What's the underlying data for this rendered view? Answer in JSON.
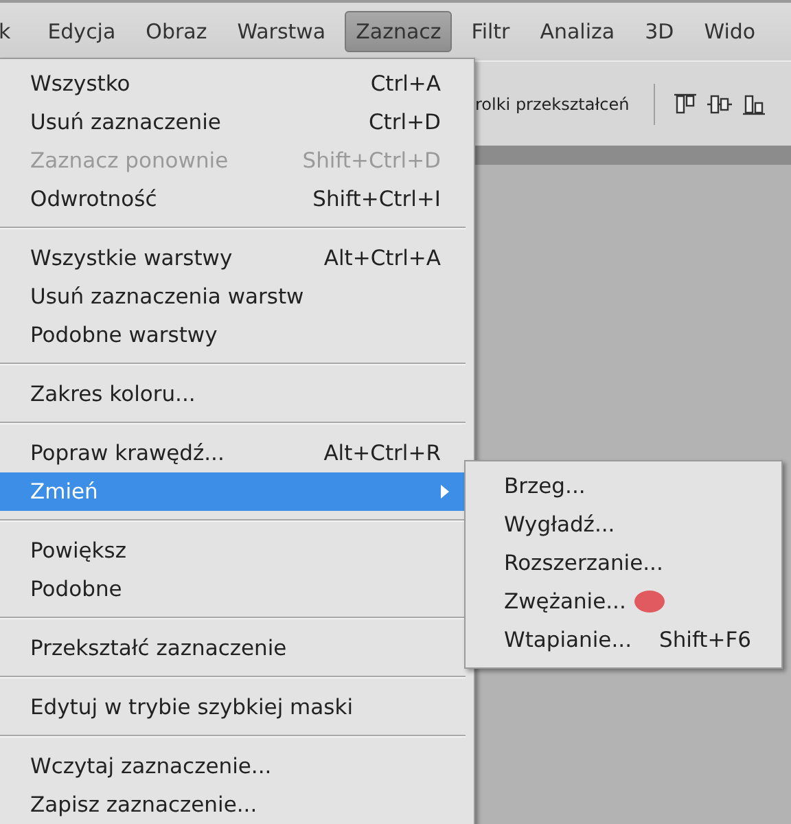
{
  "menubar": [
    {
      "label": "k",
      "selected": false
    },
    {
      "label": "Edycja",
      "selected": false
    },
    {
      "label": "Obraz",
      "selected": false
    },
    {
      "label": "Warstwa",
      "selected": false
    },
    {
      "label": "Zaznacz",
      "selected": true
    },
    {
      "label": "Filtr",
      "selected": false
    },
    {
      "label": "Analiza",
      "selected": false
    },
    {
      "label": "3D",
      "selected": false
    },
    {
      "label": "Wido",
      "selected": false
    }
  ],
  "options_bar": {
    "text": "rolki przekształceń"
  },
  "menu": {
    "sections": [
      [
        {
          "label": "Wszystko",
          "shortcut": "Ctrl+A",
          "disabled": false,
          "selected": false,
          "submenu": false
        },
        {
          "label": "Usuń zaznaczenie",
          "shortcut": "Ctrl+D",
          "disabled": false,
          "selected": false,
          "submenu": false
        },
        {
          "label": "Zaznacz ponownie",
          "shortcut": "Shift+Ctrl+D",
          "disabled": true,
          "selected": false,
          "submenu": false
        },
        {
          "label": "Odwrotność",
          "shortcut": "Shift+Ctrl+I",
          "disabled": false,
          "selected": false,
          "submenu": false
        }
      ],
      [
        {
          "label": "Wszystkie warstwy",
          "shortcut": "Alt+Ctrl+A",
          "disabled": false,
          "selected": false,
          "submenu": false
        },
        {
          "label": "Usuń zaznaczenia warstw",
          "disabled": false,
          "selected": false,
          "submenu": false
        },
        {
          "label": "Podobne warstwy",
          "disabled": false,
          "selected": false,
          "submenu": false
        }
      ],
      [
        {
          "label": "Zakres koloru...",
          "disabled": false,
          "selected": false,
          "submenu": false
        }
      ],
      [
        {
          "label": "Popraw krawędź...",
          "shortcut": "Alt+Ctrl+R",
          "disabled": false,
          "selected": false,
          "submenu": false
        },
        {
          "label": "Zmień",
          "disabled": false,
          "selected": true,
          "submenu": true
        }
      ],
      [
        {
          "label": "Powiększ",
          "disabled": false,
          "selected": false,
          "submenu": false
        },
        {
          "label": "Podobne",
          "disabled": false,
          "selected": false,
          "submenu": false
        }
      ],
      [
        {
          "label": "Przekształć zaznaczenie",
          "disabled": false,
          "selected": false,
          "submenu": false
        }
      ],
      [
        {
          "label": "Edytuj w trybie szybkiej maski",
          "disabled": false,
          "selected": false,
          "submenu": false
        }
      ],
      [
        {
          "label": "Wczytaj zaznaczenie...",
          "disabled": false,
          "selected": false,
          "submenu": false
        },
        {
          "label": "Zapisz zaznaczenie...",
          "disabled": false,
          "selected": false,
          "submenu": false
        }
      ]
    ]
  },
  "submenu": [
    {
      "label": "Brzeg...",
      "marked": false
    },
    {
      "label": "Wygładź...",
      "marked": false
    },
    {
      "label": "Rozszerzanie...",
      "marked": false
    },
    {
      "label": "Zwężanie...",
      "marked": true
    },
    {
      "label": "Wtapianie...",
      "shortcut": "Shift+F6",
      "marked": false
    }
  ]
}
